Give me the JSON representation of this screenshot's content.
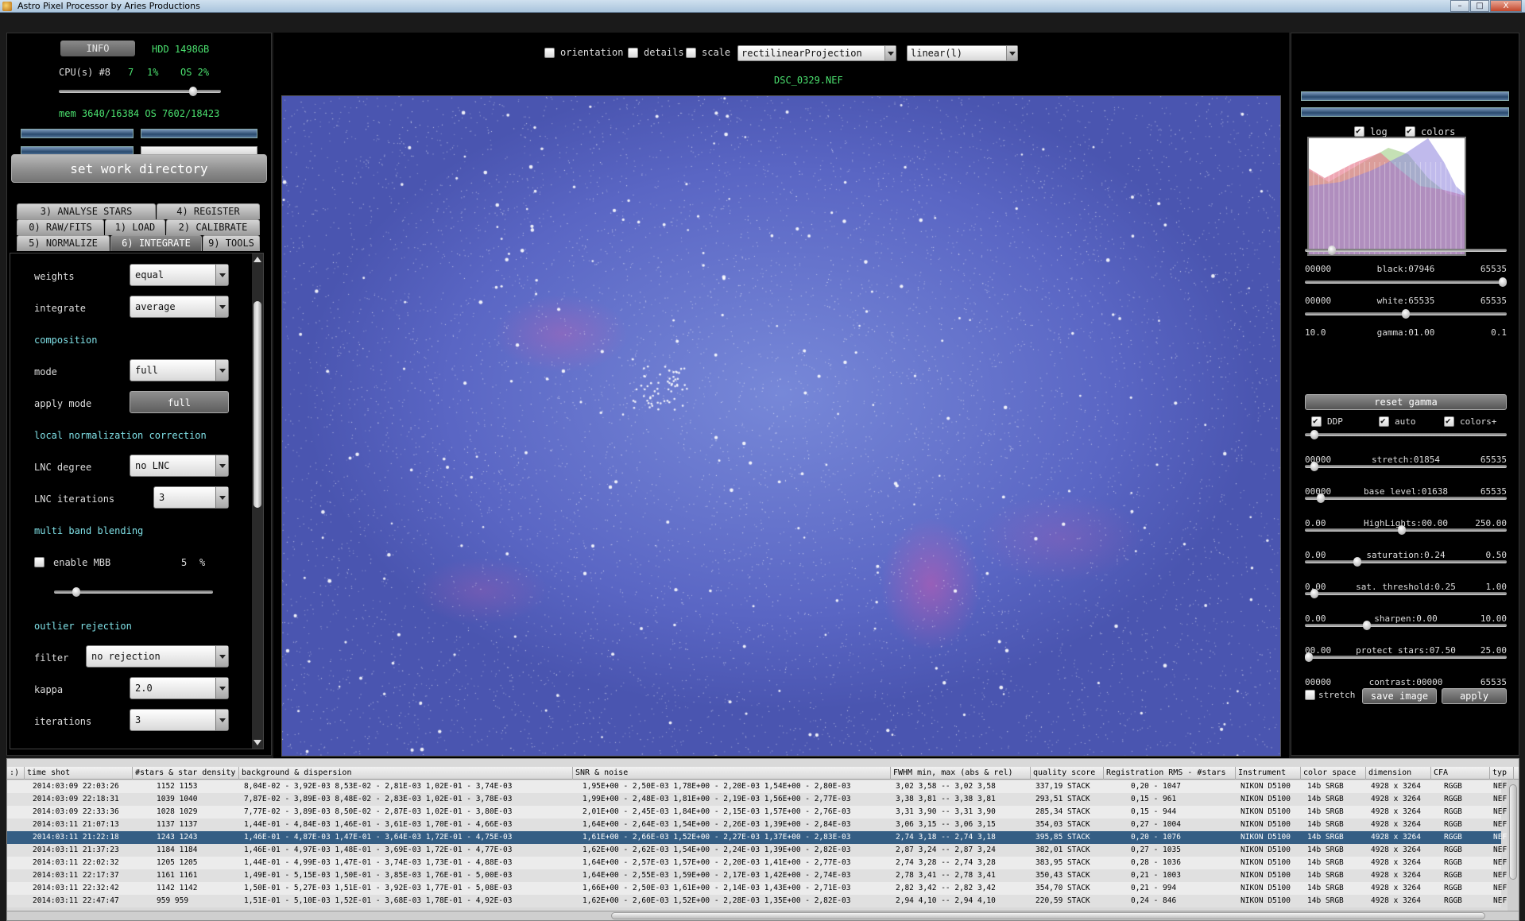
{
  "window": {
    "title": "Astro Pixel Processor by  Aries Productions",
    "minimize": "–",
    "maximize": "□",
    "close": "X"
  },
  "sys": {
    "info_label": "INFO",
    "hdd": "HDD 1498GB",
    "cpu": "CPU(s) #8",
    "cpu_a": "7",
    "cpu_b": "1%",
    "os": "OS 2%",
    "mem": "mem 3640/16384  OS 7602/18423"
  },
  "set_work_directory": "set work directory",
  "tabs": [
    {
      "label": "3) ANALYSE STARS"
    },
    {
      "label": "4) REGISTER"
    },
    {
      "label": "0) RAW/FITS"
    },
    {
      "label": "1) LOAD"
    },
    {
      "label": "2) CALIBRATE"
    },
    {
      "label": "5) NORMALIZE"
    },
    {
      "label": "6) INTEGRATE"
    },
    {
      "label": "9) TOOLS"
    }
  ],
  "integrate": {
    "weights_label": "weights",
    "weights_value": "equal",
    "integrate_label": "integrate",
    "integrate_value": "average",
    "composition_label": "composition",
    "mode_label": "mode",
    "mode_value": "full",
    "apply_mode_label": "apply mode",
    "apply_mode_button": "full",
    "lnc_label": "local normalization correction",
    "lnc_degree_label": "LNC degree",
    "lnc_degree_value": "no LNC",
    "lnc_iter_label": "LNC iterations",
    "lnc_iter_value": "3",
    "mbb_label": "multi band blending",
    "enable_mbb_label": "enable MBB",
    "mbb_value": "5",
    "mbb_unit": "%",
    "mbb_level": 0.12,
    "outlier_label": "outlier rejection",
    "filter_label": "filter",
    "filter_value": "no rejection",
    "kappa_label": "kappa",
    "kappa_value": "2.0",
    "iterations_label": "iterations",
    "iterations_value": "3"
  },
  "toolbar": {
    "orientation": "orientation",
    "details": "details",
    "scale": "scale",
    "projection": "rectilinearProjection",
    "stretch_mode": "linear(l)",
    "filename": "DSC_0329.NEF"
  },
  "right": {
    "log_label": "log",
    "colors_label": "colors",
    "black": {
      "min": "00000",
      "label": "black:07946",
      "max": "65535",
      "level": 0.12
    },
    "white": {
      "min": "00000",
      "label": "white:65535",
      "max": "65535",
      "level": 1.0
    },
    "gamma": {
      "min": "10.0",
      "label": "gamma:01.00",
      "max": "0.1",
      "level": 0.5
    },
    "reset_gamma": "reset gamma",
    "ddp_label": "DDP",
    "auto_label": "auto",
    "colors_plus_label": "colors+",
    "stretch": {
      "min": "00000",
      "label": "stretch:01854",
      "max": "65535",
      "level": 0.03
    },
    "base_level": {
      "min": "00000",
      "label": "base level:01638",
      "max": "65535",
      "level": 0.03
    },
    "highlights": {
      "min": "0.00",
      "label": "HighLights:00.00",
      "max": "250.00",
      "level": 0.06
    },
    "saturation": {
      "min": "0.00",
      "label": "saturation:0.24",
      "max": "0.50",
      "level": 0.48
    },
    "sat_threshold": {
      "min": "0.00",
      "label": "sat. threshold:0.25",
      "max": "1.00",
      "level": 0.25
    },
    "sharpen": {
      "min": "0.00",
      "label": "sharpen:0.00",
      "max": "10.00",
      "level": 0.03
    },
    "protect_stars": {
      "min": "00.00",
      "label": "protect stars:07.50",
      "max": "25.00",
      "level": 0.3
    },
    "contrast": {
      "min": "00000",
      "label": "contrast:00000",
      "max": "65535",
      "level": 0.0
    },
    "stretch_chk_label": "stretch",
    "save_image": "save image",
    "apply": "apply"
  },
  "table": {
    "headers": [
      ":)",
      "time shot",
      "#stars & star density",
      "background & dispersion",
      "SNR & noise",
      "FWHM min, max (abs & rel)",
      "quality score",
      "Registration RMS - #stars",
      "Instrument",
      "color space",
      "dimension",
      "CFA",
      "typ"
    ],
    "rows": [
      [
        "",
        "2014:03:09 22:03:26",
        "1152 1153",
        "8,04E-02 - 3,92E-03  8,53E-02 - 2,81E-03  1,02E-01 - 3,74E-03",
        "1,95E+00 - 2,50E-03  1,78E+00 - 2,20E-03  1,54E+00 - 2,80E-03",
        "3,02 3,58 -- 3,02 3,58",
        "337,19 STACK",
        "0,20 - 1047",
        "NIKON D5100",
        "14b SRGB",
        "4928 x 3264",
        "RGGB",
        "NEF"
      ],
      [
        "",
        "2014:03:09 22:18:31",
        "1039 1040",
        "7,87E-02 - 3,89E-03  8,48E-02 - 2,83E-03  1,02E-01 - 3,78E-03",
        "1,99E+00 - 2,48E-03  1,81E+00 - 2,19E-03  1,56E+00 - 2,77E-03",
        "3,38 3,81 -- 3,38 3,81",
        "293,51 STACK",
        "0,15 - 961",
        "NIKON D5100",
        "14b SRGB",
        "4928 x 3264",
        "RGGB",
        "NEF"
      ],
      [
        "",
        "2014:03:09 22:33:36",
        "1028 1029",
        "7,77E-02 - 3,89E-03  8,50E-02 - 2,87E-03  1,02E-01 - 3,80E-03",
        "2,01E+00 - 2,45E-03  1,84E+00 - 2,15E-03  1,57E+00 - 2,76E-03",
        "3,31 3,90 -- 3,31 3,90",
        "285,34 STACK",
        "0,15 - 944",
        "NIKON D5100",
        "14b SRGB",
        "4928 x 3264",
        "RGGB",
        "NEF"
      ],
      [
        "",
        "2014:03:11 21:07:13",
        "1137 1137",
        "1,44E-01 - 4,84E-03  1,46E-01 - 3,61E-03  1,70E-01 - 4,66E-03",
        "1,64E+00 - 2,64E-03  1,54E+00 - 2,26E-03  1,39E+00 - 2,84E-03",
        "3,06 3,15 -- 3,06 3,15",
        "354,03 STACK",
        "0,27 - 1004",
        "NIKON D5100",
        "14b SRGB",
        "4928 x 3264",
        "RGGB",
        "NEF"
      ],
      [
        "",
        "2014:03:11 21:22:18",
        "1243 1243",
        "1,46E-01 - 4,87E-03  1,47E-01 - 3,64E-03  1,72E-01 - 4,75E-03",
        "1,61E+00 - 2,66E-03  1,52E+00 - 2,27E-03  1,37E+00 - 2,83E-03",
        "2,74 3,18 -- 2,74 3,18",
        "395,85 STACK",
        "0,20 - 1076",
        "NIKON D5100",
        "14b SRGB",
        "4928 x 3264",
        "RGGB",
        "NEF"
      ],
      [
        "",
        "2014:03:11 21:37:23",
        "1184 1184",
        "1,46E-01 - 4,97E-03  1,48E-01 - 3,69E-03  1,72E-01 - 4,77E-03",
        "1,62E+00 - 2,62E-03  1,54E+00 - 2,24E-03  1,39E+00 - 2,82E-03",
        "2,87 3,24 -- 2,87 3,24",
        "382,01 STACK",
        "0,27 - 1035",
        "NIKON D5100",
        "14b SRGB",
        "4928 x 3264",
        "RGGB",
        "NEF"
      ],
      [
        "",
        "2014:03:11 22:02:32",
        "1205 1205",
        "1,44E-01 - 4,99E-03  1,47E-01 - 3,74E-03  1,73E-01 - 4,88E-03",
        "1,64E+00 - 2,57E-03  1,57E+00 - 2,20E-03  1,41E+00 - 2,77E-03",
        "2,74 3,28 -- 2,74 3,28",
        "383,95 STACK",
        "0,28 - 1036",
        "NIKON D5100",
        "14b SRGB",
        "4928 x 3264",
        "RGGB",
        "NEF"
      ],
      [
        "",
        "2014:03:11 22:17:37",
        "1161 1161",
        "1,49E-01 - 5,15E-03  1,50E-01 - 3,85E-03  1,76E-01 - 5,00E-03",
        "1,64E+00 - 2,55E-03  1,59E+00 - 2,17E-03  1,42E+00 - 2,74E-03",
        "2,78 3,41 -- 2,78 3,41",
        "350,43 STACK",
        "0,21 - 1003",
        "NIKON D5100",
        "14b SRGB",
        "4928 x 3264",
        "RGGB",
        "NEF"
      ],
      [
        "",
        "2014:03:11 22:32:42",
        "1142 1142",
        "1,50E-01 - 5,27E-03  1,51E-01 - 3,92E-03  1,77E-01 - 5,08E-03",
        "1,66E+00 - 2,50E-03  1,61E+00 - 2,14E-03  1,43E+00 - 2,71E-03",
        "2,82 3,42 -- 2,82 3,42",
        "354,70 STACK",
        "0,21 - 994",
        "NIKON D5100",
        "14b SRGB",
        "4928 x 3264",
        "RGGB",
        "NEF"
      ],
      [
        "",
        "2014:03:11 22:47:47",
        "959 959",
        "1,51E-01 - 5,10E-03  1,52E-01 - 3,68E-03  1,78E-01 - 4,92E-03",
        "1,62E+00 - 2,60E-03  1,52E+00 - 2,28E-03  1,35E+00 - 2,82E-03",
        "2,94 4,10 -- 2,94 4,10",
        "220,59 STACK",
        "0,24 - 846",
        "NIKON D5100",
        "14b SRGB",
        "4928 x 3264",
        "RGGB",
        "NEF"
      ]
    ]
  }
}
